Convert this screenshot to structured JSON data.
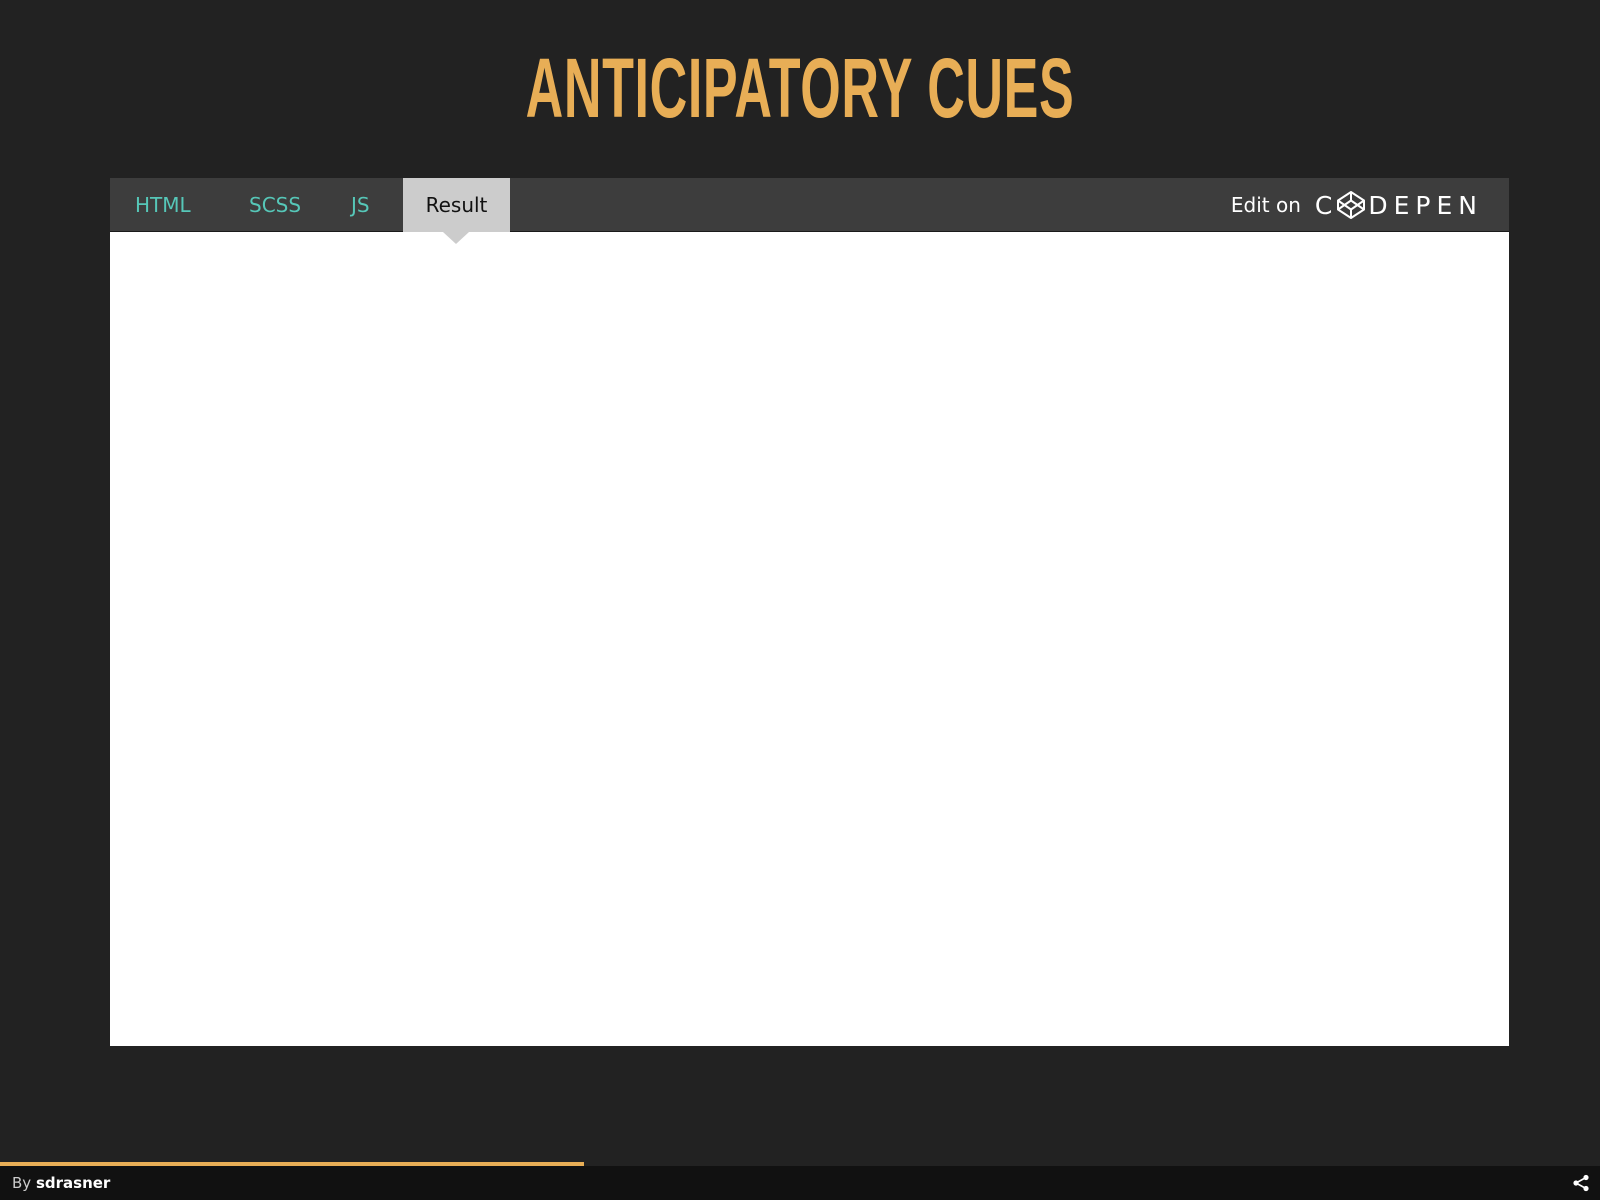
{
  "page": {
    "title": "ANTICIPATORY CUES"
  },
  "embed": {
    "tabs": [
      {
        "label": "HTML",
        "active": false
      },
      {
        "label": "SCSS",
        "active": false
      },
      {
        "label": "JS",
        "active": false
      },
      {
        "label": "Result",
        "active": true
      }
    ],
    "edit_on_label": "Edit on",
    "logo_text_before": "C",
    "logo_text_after": "DEPEN",
    "logo_icon": "codepen-cube-icon"
  },
  "footer": {
    "by_label": "By",
    "author": "sdrasner",
    "progress": 0.365,
    "share_icon": "share-icon"
  },
  "colors": {
    "background": "#222222",
    "title": "#E8AE56",
    "tab_text": "#56C7B8",
    "tab_bar": "#3D3D3D",
    "active_tab": "#CCCCCC",
    "progress": "#E8AE56"
  }
}
